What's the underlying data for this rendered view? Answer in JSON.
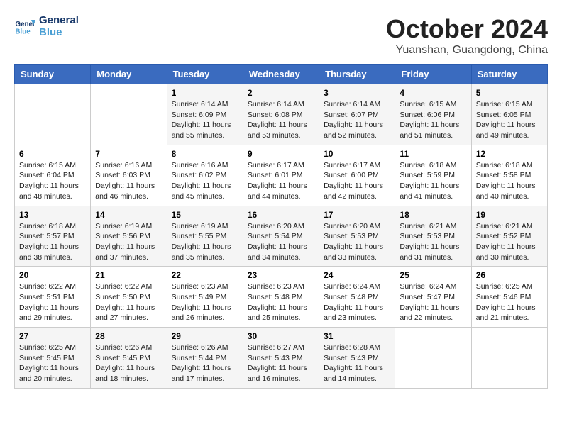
{
  "header": {
    "logo_line1": "General",
    "logo_line2": "Blue",
    "month": "October 2024",
    "location": "Yuanshan, Guangdong, China"
  },
  "weekdays": [
    "Sunday",
    "Monday",
    "Tuesday",
    "Wednesday",
    "Thursday",
    "Friday",
    "Saturday"
  ],
  "weeks": [
    [
      {
        "day": "",
        "info": ""
      },
      {
        "day": "",
        "info": ""
      },
      {
        "day": "1",
        "info": "Sunrise: 6:14 AM\nSunset: 6:09 PM\nDaylight: 11 hours and 55 minutes."
      },
      {
        "day": "2",
        "info": "Sunrise: 6:14 AM\nSunset: 6:08 PM\nDaylight: 11 hours and 53 minutes."
      },
      {
        "day": "3",
        "info": "Sunrise: 6:14 AM\nSunset: 6:07 PM\nDaylight: 11 hours and 52 minutes."
      },
      {
        "day": "4",
        "info": "Sunrise: 6:15 AM\nSunset: 6:06 PM\nDaylight: 11 hours and 51 minutes."
      },
      {
        "day": "5",
        "info": "Sunrise: 6:15 AM\nSunset: 6:05 PM\nDaylight: 11 hours and 49 minutes."
      }
    ],
    [
      {
        "day": "6",
        "info": "Sunrise: 6:15 AM\nSunset: 6:04 PM\nDaylight: 11 hours and 48 minutes."
      },
      {
        "day": "7",
        "info": "Sunrise: 6:16 AM\nSunset: 6:03 PM\nDaylight: 11 hours and 46 minutes."
      },
      {
        "day": "8",
        "info": "Sunrise: 6:16 AM\nSunset: 6:02 PM\nDaylight: 11 hours and 45 minutes."
      },
      {
        "day": "9",
        "info": "Sunrise: 6:17 AM\nSunset: 6:01 PM\nDaylight: 11 hours and 44 minutes."
      },
      {
        "day": "10",
        "info": "Sunrise: 6:17 AM\nSunset: 6:00 PM\nDaylight: 11 hours and 42 minutes."
      },
      {
        "day": "11",
        "info": "Sunrise: 6:18 AM\nSunset: 5:59 PM\nDaylight: 11 hours and 41 minutes."
      },
      {
        "day": "12",
        "info": "Sunrise: 6:18 AM\nSunset: 5:58 PM\nDaylight: 11 hours and 40 minutes."
      }
    ],
    [
      {
        "day": "13",
        "info": "Sunrise: 6:18 AM\nSunset: 5:57 PM\nDaylight: 11 hours and 38 minutes."
      },
      {
        "day": "14",
        "info": "Sunrise: 6:19 AM\nSunset: 5:56 PM\nDaylight: 11 hours and 37 minutes."
      },
      {
        "day": "15",
        "info": "Sunrise: 6:19 AM\nSunset: 5:55 PM\nDaylight: 11 hours and 35 minutes."
      },
      {
        "day": "16",
        "info": "Sunrise: 6:20 AM\nSunset: 5:54 PM\nDaylight: 11 hours and 34 minutes."
      },
      {
        "day": "17",
        "info": "Sunrise: 6:20 AM\nSunset: 5:53 PM\nDaylight: 11 hours and 33 minutes."
      },
      {
        "day": "18",
        "info": "Sunrise: 6:21 AM\nSunset: 5:53 PM\nDaylight: 11 hours and 31 minutes."
      },
      {
        "day": "19",
        "info": "Sunrise: 6:21 AM\nSunset: 5:52 PM\nDaylight: 11 hours and 30 minutes."
      }
    ],
    [
      {
        "day": "20",
        "info": "Sunrise: 6:22 AM\nSunset: 5:51 PM\nDaylight: 11 hours and 29 minutes."
      },
      {
        "day": "21",
        "info": "Sunrise: 6:22 AM\nSunset: 5:50 PM\nDaylight: 11 hours and 27 minutes."
      },
      {
        "day": "22",
        "info": "Sunrise: 6:23 AM\nSunset: 5:49 PM\nDaylight: 11 hours and 26 minutes."
      },
      {
        "day": "23",
        "info": "Sunrise: 6:23 AM\nSunset: 5:48 PM\nDaylight: 11 hours and 25 minutes."
      },
      {
        "day": "24",
        "info": "Sunrise: 6:24 AM\nSunset: 5:48 PM\nDaylight: 11 hours and 23 minutes."
      },
      {
        "day": "25",
        "info": "Sunrise: 6:24 AM\nSunset: 5:47 PM\nDaylight: 11 hours and 22 minutes."
      },
      {
        "day": "26",
        "info": "Sunrise: 6:25 AM\nSunset: 5:46 PM\nDaylight: 11 hours and 21 minutes."
      }
    ],
    [
      {
        "day": "27",
        "info": "Sunrise: 6:25 AM\nSunset: 5:45 PM\nDaylight: 11 hours and 20 minutes."
      },
      {
        "day": "28",
        "info": "Sunrise: 6:26 AM\nSunset: 5:45 PM\nDaylight: 11 hours and 18 minutes."
      },
      {
        "day": "29",
        "info": "Sunrise: 6:26 AM\nSunset: 5:44 PM\nDaylight: 11 hours and 17 minutes."
      },
      {
        "day": "30",
        "info": "Sunrise: 6:27 AM\nSunset: 5:43 PM\nDaylight: 11 hours and 16 minutes."
      },
      {
        "day": "31",
        "info": "Sunrise: 6:28 AM\nSunset: 5:43 PM\nDaylight: 11 hours and 14 minutes."
      },
      {
        "day": "",
        "info": ""
      },
      {
        "day": "",
        "info": ""
      }
    ]
  ]
}
